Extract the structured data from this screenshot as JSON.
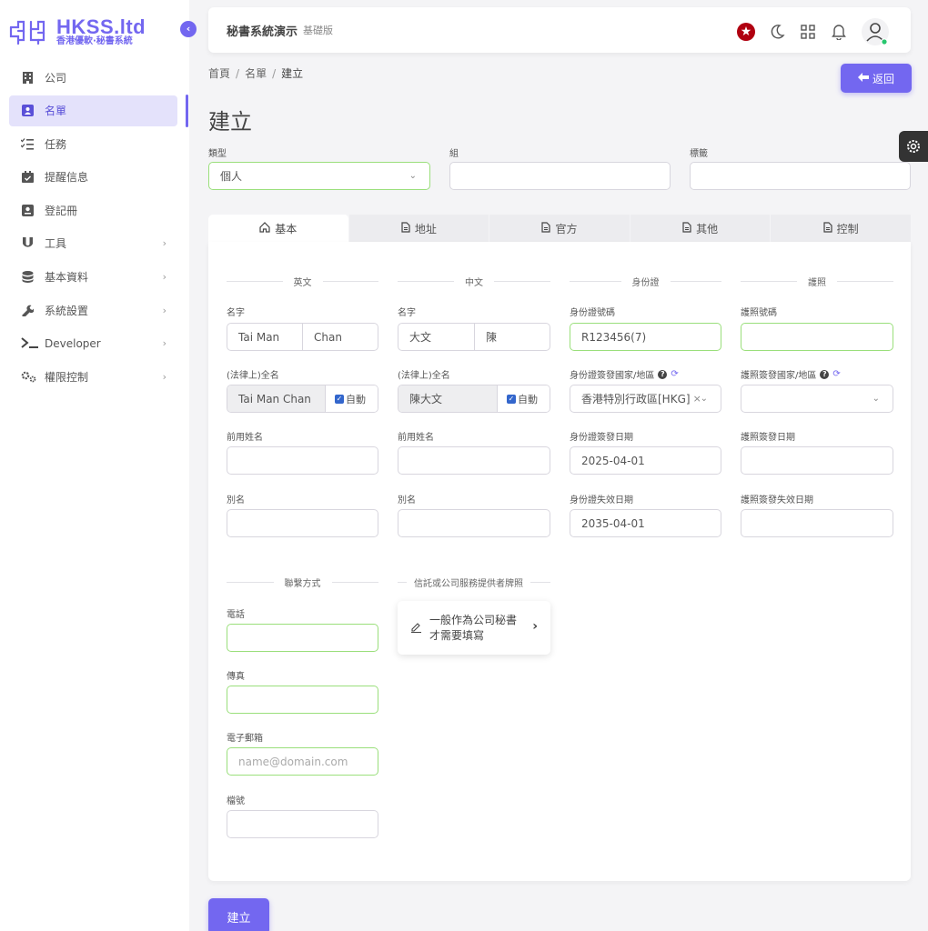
{
  "brand": {
    "title": "HKSS.ltd",
    "subtitle": "香港優軟·秘書系統",
    "accent": "#7367f0"
  },
  "sidebar": {
    "items": [
      {
        "label": "公司",
        "icon": "building-icon"
      },
      {
        "label": "名單",
        "icon": "contact-card-icon",
        "active": true
      },
      {
        "label": "任務",
        "icon": "checklist-icon"
      },
      {
        "label": "提醒信息",
        "icon": "calendar-check-icon"
      },
      {
        "label": "登記冊",
        "icon": "register-book-icon"
      },
      {
        "label": "工具",
        "icon": "magnet-icon",
        "chevron": true
      },
      {
        "label": "基本資料",
        "icon": "database-icon",
        "chevron": true
      },
      {
        "label": "系統設置",
        "icon": "wrench-icon",
        "chevron": true
      },
      {
        "label": "Developer",
        "icon": "terminal-icon",
        "chevron": true
      },
      {
        "label": "權限控制",
        "icon": "cogs-icon",
        "chevron": true
      }
    ]
  },
  "navbar": {
    "title": "秘書系統演示",
    "subtitle": "基礎版"
  },
  "breadcrumb": {
    "home": "首頁",
    "list": "名單",
    "current": "建立"
  },
  "actions": {
    "back": "返回",
    "create": "建立"
  },
  "page": {
    "title": "建立"
  },
  "top_fields": {
    "type_label": "類型",
    "type_value": "個人",
    "group_label": "組",
    "tag_label": "標籤"
  },
  "tabs": [
    {
      "label": "基本",
      "icon": "home-icon"
    },
    {
      "label": "地址",
      "icon": "document-icon"
    },
    {
      "label": "官方",
      "icon": "document-icon"
    },
    {
      "label": "其他",
      "icon": "document-icon"
    },
    {
      "label": "控制",
      "icon": "document-icon"
    }
  ],
  "sections": {
    "english": "英文",
    "chinese": "中文",
    "id_card": "身份證",
    "passport": "護照",
    "contact": "聯繫方式",
    "tcsp": "信託或公司服務提供者牌照"
  },
  "english": {
    "name_label": "名字",
    "first": "Tai Man",
    "last": "Chan",
    "legal_label": "(法律上)全名",
    "legal_value": "Tai Man Chan",
    "auto": "自動",
    "former_label": "前用姓名",
    "alias_label": "別名"
  },
  "chinese": {
    "name_label": "名字",
    "first": "大文",
    "last": "陳",
    "legal_label": "(法律上)全名",
    "legal_value": "陳大文",
    "auto": "自動",
    "former_label": "前用姓名",
    "alias_label": "別名"
  },
  "id_card": {
    "number_label": "身份證號碼",
    "number": "R123456(7)",
    "country_label": "身份證簽發國家/地區",
    "country": "香港特別行政區[HKG]",
    "issue_label": "身份證簽發日期",
    "issue": "2025-04-01",
    "expiry_label": "身份證失效日期",
    "expiry": "2035-04-01"
  },
  "passport": {
    "number_label": "護照號碼",
    "country_label": "護照簽發國家/地區",
    "issue_label": "護照簽發日期",
    "expiry_label": "護照簽發失效日期"
  },
  "contact": {
    "phone_label": "電話",
    "fax_label": "傳真",
    "email_label": "電子郵箱",
    "email_placeholder": "name@domain.com",
    "file_label": "檔號"
  },
  "tcsp": {
    "line1": "一般作為公司秘書",
    "line2": "才需要填寫"
  }
}
